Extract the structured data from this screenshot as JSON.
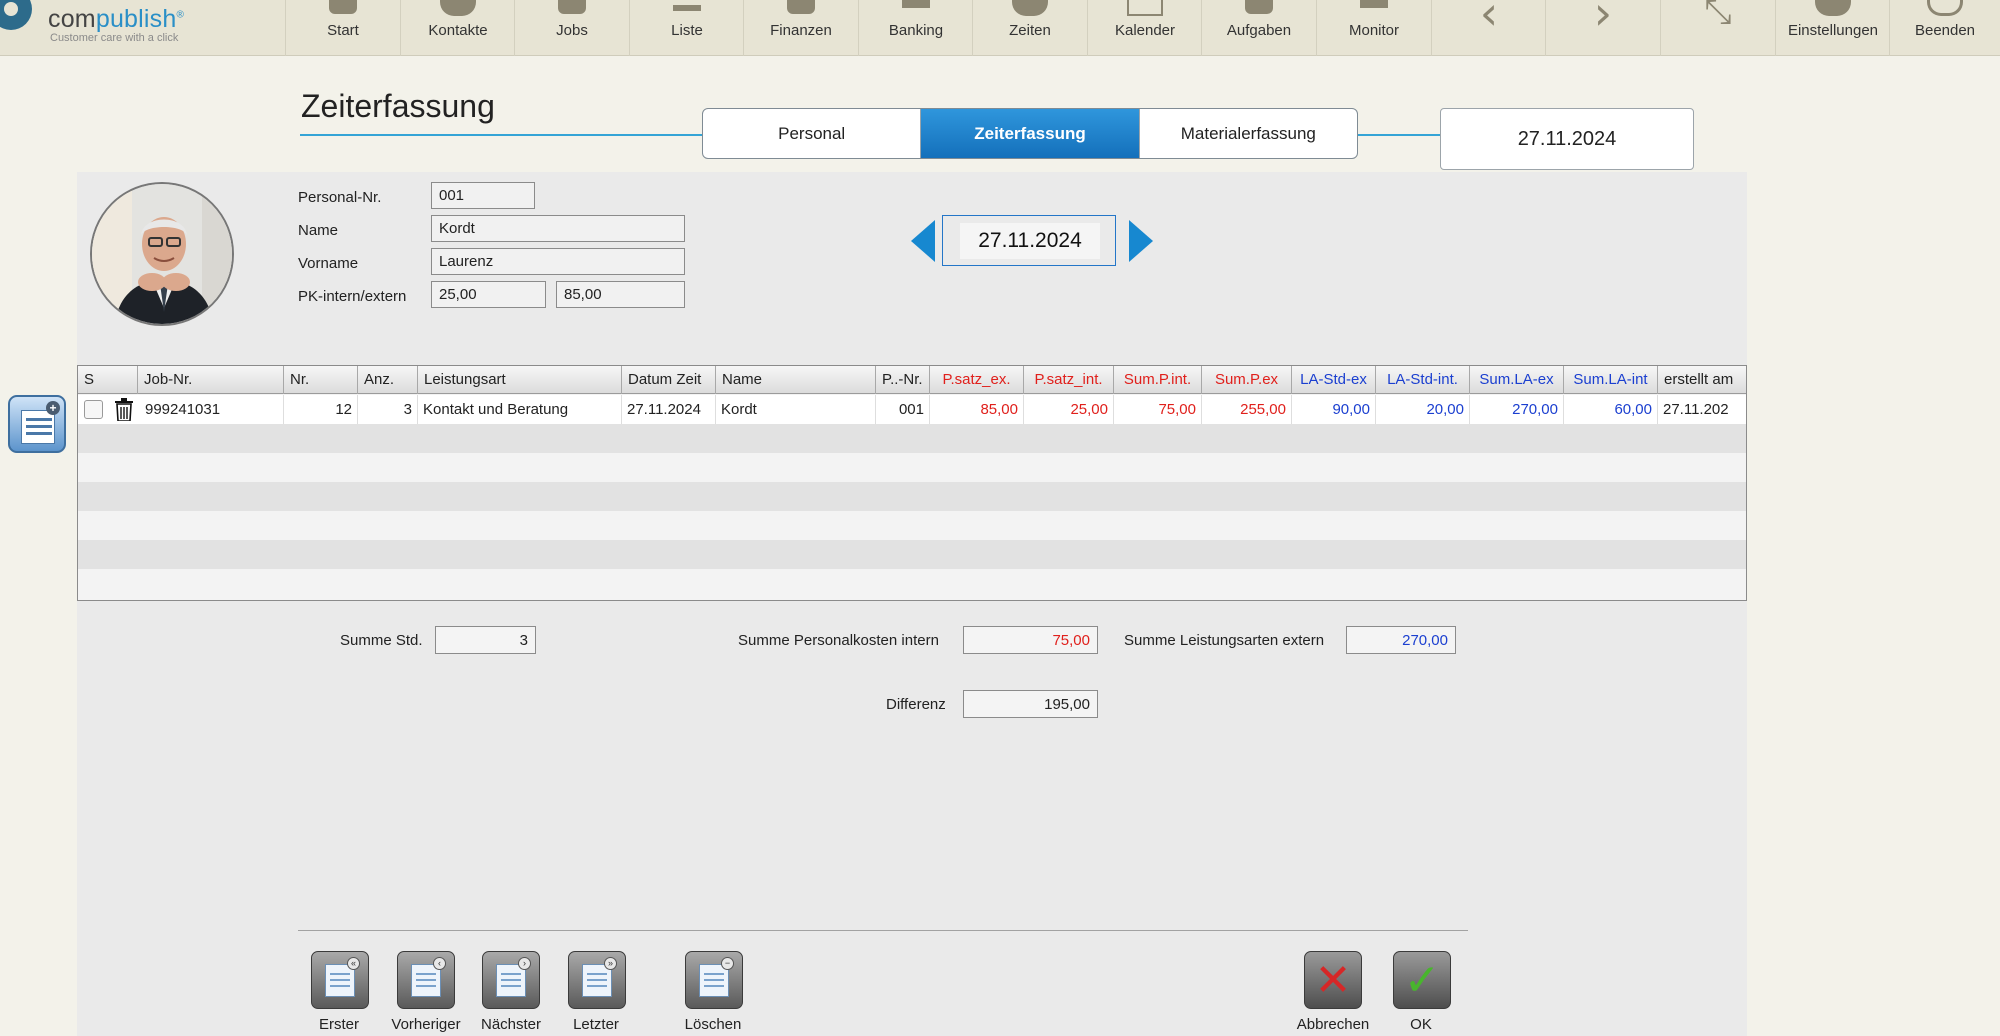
{
  "logo": {
    "brand_prefix": "com",
    "brand_suffix": "publish",
    "mark": "®",
    "tagline": "Customer care with a click"
  },
  "nav": [
    {
      "label": "Start",
      "icon": "house-icon"
    },
    {
      "label": "Kontakte",
      "icon": "person-icon"
    },
    {
      "label": "Jobs",
      "icon": "stack-icon"
    },
    {
      "label": "Liste",
      "icon": "list-icon"
    },
    {
      "label": "Finanzen",
      "icon": "pen-icon"
    },
    {
      "label": "Banking",
      "icon": "monitor-icon"
    },
    {
      "label": "Zeiten",
      "icon": "clock-icon"
    },
    {
      "label": "Kalender",
      "icon": "calendar-icon"
    },
    {
      "label": "Aufgaben",
      "icon": "tasks-icon"
    },
    {
      "label": "Monitor",
      "icon": "monitor-icon"
    },
    {
      "label": "",
      "icon": "chevron-left-icon",
      "glyph": "‹"
    },
    {
      "label": "",
      "icon": "chevron-right-icon",
      "glyph": "›"
    },
    {
      "label": "",
      "icon": "collapse-icon",
      "glyph": "⤡"
    },
    {
      "label": "Einstellungen",
      "icon": "gear-icon"
    },
    {
      "label": "Beenden",
      "icon": "power-icon"
    }
  ],
  "page": {
    "title": "Zeiterfassung",
    "tabs": [
      "Personal",
      "Zeiterfassung",
      "Materialerfassung"
    ],
    "active_tab": "Zeiterfassung",
    "top_date": "27.11.2024"
  },
  "person": {
    "nr_label": "Personal-Nr.",
    "nr": "001",
    "name_label": "Name",
    "name": "Kordt",
    "vorname_label": "Vorname",
    "vorname": "Laurenz",
    "pk_label": "PK-intern/extern",
    "pk_intern": "25,00",
    "pk_extern": "85,00"
  },
  "date_nav": {
    "date": "27.11.2024"
  },
  "table": {
    "headers": {
      "s": "S",
      "job": "Job-Nr.",
      "nr": "Nr.",
      "anz": "Anz.",
      "leistungsart": "Leistungsart",
      "datum": "Datum Zeit",
      "name": "Name",
      "pnr": "P..-Nr.",
      "psatz_ex": "P.satz_ex.",
      "psatz_int": "P.satz_int.",
      "sum_p_int": "Sum.P.int.",
      "sum_p_ex": "Sum.P.ex",
      "la_std_ex": "LA-Std-ex",
      "la_std_int": "LA-Std-int.",
      "sum_la_ex": "Sum.LA-ex",
      "sum_la_int": "Sum.LA-int",
      "erstellt": "erstellt am"
    },
    "rows": [
      {
        "job": "999241031",
        "nr": "12",
        "anz": "3",
        "leistungsart": "Kontakt und Beratung",
        "datum": "27.11.2024",
        "name": "Kordt",
        "pnr": "001",
        "psatz_ex": "85,00",
        "psatz_int": "25,00",
        "sum_p_int": "75,00",
        "sum_p_ex": "255,00",
        "la_std_ex": "90,00",
        "la_std_int": "20,00",
        "sum_la_ex": "270,00",
        "sum_la_int": "60,00",
        "erstellt": "27.11.202"
      }
    ]
  },
  "summary": {
    "std_label": "Summe Std.",
    "std": "3",
    "pk_label": "Summe Personalkosten intern",
    "pk": "75,00",
    "la_label": "Summe Leistungsarten extern",
    "la": "270,00",
    "diff_label": "Differenz",
    "diff": "195,00"
  },
  "buttons": {
    "first": "Erster",
    "prev": "Vorheriger",
    "next": "Nächster",
    "last": "Letzter",
    "delete": "Löschen",
    "cancel": "Abbrechen",
    "ok": "OK"
  },
  "colors": {
    "accent": "#1788d0",
    "tab_active": "#1e80c8",
    "red": "#e0201c",
    "blue": "#1b3fd0"
  }
}
